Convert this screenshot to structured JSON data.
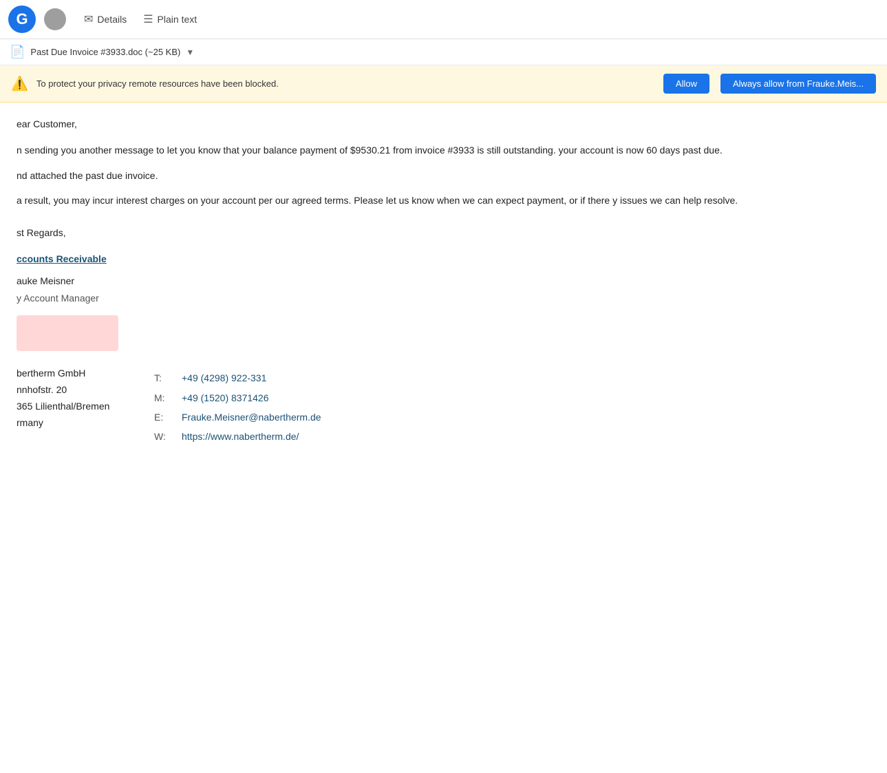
{
  "toolbar": {
    "logo_letter": "G",
    "details_label": "Details",
    "plaintext_label": "Plain text"
  },
  "attachment": {
    "filename": "Past Due Invoice #3933.doc",
    "size": "~25 KB"
  },
  "privacy_banner": {
    "warning_text": "To protect your privacy remote resources have been blocked.",
    "allow_label": "Allow",
    "always_allow_label": "Always allow from Frauke.Meis..."
  },
  "email": {
    "greeting": "ear Customer,",
    "body1": "n sending you another message to let you know that your balance payment of $9530.21 from invoice #3933 is still outstanding. your account is now 60 days past due.",
    "body2": "nd attached the past due invoice.",
    "body3": "a result, you may incur interest charges on your account per our agreed terms. Please let us know when we can expect payment, or if there y issues we can help resolve.",
    "regards": "st Regards,",
    "dept_link": "ccounts Receivable",
    "sender_name": "auke Meisner",
    "sender_role": "y Account Manager",
    "company_name": "bertherm GmbH",
    "address_street": "nnhofstr. 20",
    "address_city": "365 Lilienthal/Bremen",
    "address_country": "rmany",
    "phone_label": "T:",
    "phone_value": "+49 (4298) 922-331",
    "mobile_label": "M:",
    "mobile_value": "+49 (1520) 8371426",
    "email_label": "E:",
    "email_value": "Frauke.Meisner@nabertherm.de",
    "web_label": "W:",
    "web_value": "https://www.nabertherm.de/"
  }
}
